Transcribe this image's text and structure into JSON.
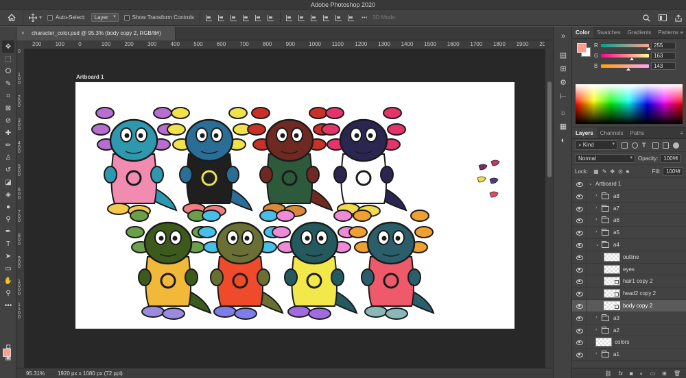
{
  "app": {
    "title": "Adobe Photoshop 2020"
  },
  "options": {
    "auto_select_label": "Auto-Select:",
    "auto_select_value": "Layer",
    "transform_label": "Show Transform Controls",
    "mode_3d": "3D Mode:"
  },
  "document": {
    "tab_title": "character_color.psd @ 95.3% (body copy 2, RGB/8#)"
  },
  "ruler": {
    "h_ticks": [
      "200",
      "100",
      "0",
      "100",
      "200",
      "300",
      "400",
      "500",
      "600",
      "700",
      "800",
      "900",
      "1000",
      "1100",
      "1200",
      "1300",
      "1400",
      "1500",
      "1600",
      "1700",
      "1800",
      "1900",
      "2000"
    ],
    "v_ticks": [
      "0",
      "100",
      "200",
      "300",
      "400",
      "500",
      "600",
      "700",
      "800",
      "900",
      "1000",
      "1100"
    ]
  },
  "canvas": {
    "artboard_label": "Artboard 1"
  },
  "status": {
    "zoom": "95.31%",
    "dimensions": "1920 px x 1080 px (72 ppi)"
  },
  "color_panel": {
    "tabs": [
      "Color",
      "Swatches",
      "Gradients",
      "Patterns"
    ],
    "active_tab": "Color",
    "foreground": "#ff9d8c",
    "background": "#ffffff",
    "r_label": "R",
    "r_value": "255",
    "g_label": "G",
    "g_value": "163",
    "b_label": "B",
    "b_value": "143"
  },
  "layers_panel": {
    "tabs": [
      "Layers",
      "Channels",
      "Paths"
    ],
    "active_tab": "Layers",
    "filter": "Kind",
    "blend_mode": "Normal",
    "opacity_label": "Opacity:",
    "opacity_value": "100%",
    "lock_label": "Lock:",
    "fill_label": "Fill:",
    "fill_value": "100%",
    "layers": [
      {
        "name": "Artboard 1",
        "kind": "artboard",
        "expanded": true
      },
      {
        "name": "a8",
        "kind": "group"
      },
      {
        "name": "a7",
        "kind": "group"
      },
      {
        "name": "a6",
        "kind": "group"
      },
      {
        "name": "a5",
        "kind": "group"
      },
      {
        "name": "a4",
        "kind": "group",
        "expanded": true
      },
      {
        "name": "outline",
        "kind": "layer"
      },
      {
        "name": "eyes",
        "kind": "layer"
      },
      {
        "name": "hair1 copy 2",
        "kind": "smart"
      },
      {
        "name": "head2 copy 2",
        "kind": "smart"
      },
      {
        "name": "body copy 2",
        "kind": "smart",
        "selected": true
      },
      {
        "name": "a3",
        "kind": "group"
      },
      {
        "name": "a2",
        "kind": "group"
      },
      {
        "name": "colors",
        "kind": "layer-top"
      },
      {
        "name": "a1",
        "kind": "group"
      }
    ]
  },
  "characters": [
    {
      "head": "#2e98ae",
      "gills": "#b66ed0",
      "body": "#f28bb0",
      "feet": "#f3c94e"
    },
    {
      "head": "#2a6e98",
      "gills": "#f0e34a",
      "body": "#1f1f1f",
      "feet": "#f07e7e"
    },
    {
      "head": "#6e2a22",
      "gills": "#c9302a",
      "body": "#2c5a3a",
      "feet": "#d88a3a"
    },
    {
      "head": "#2a2650",
      "gills": "#e3356a",
      "body": "#ffffff",
      "feet": "#f3d94e"
    },
    {
      "head": "#3c5a1c",
      "gills": "#6aa04a",
      "body": "#f2b83a",
      "feet": "#9a8ae0"
    },
    {
      "head": "#6a7034",
      "gills": "#46c0e8",
      "body": "#ef4a2a",
      "feet": "#7e7ee8"
    },
    {
      "head": "#245a5e",
      "gills": "#f08ad8",
      "body": "#f3e84a",
      "feet": "#a06ae0"
    },
    {
      "head": "#2a5e6a",
      "gills": "#f0a030",
      "body": "#ee5a6a",
      "feet": "#8ab8b8"
    }
  ],
  "palette_swatches": [
    "#7a2a6a",
    "#c8385a",
    "#f2e03a",
    "#4a3a8a",
    "#e8485a"
  ]
}
